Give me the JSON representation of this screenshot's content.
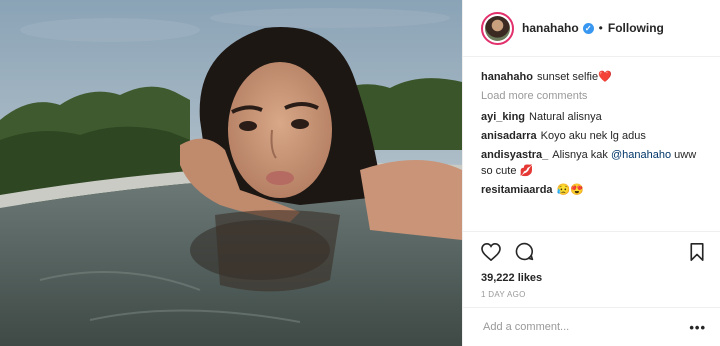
{
  "post": {
    "username": "hanahaho",
    "follow_status": "Following",
    "separator": "•",
    "caption": {
      "user": "hanahaho",
      "text": "sunset selfie",
      "emoji": "❤️"
    },
    "load_more": "Load more comments",
    "comments": [
      {
        "user": "ayi_king",
        "text": "Natural alisnya"
      },
      {
        "user": "anisadarra",
        "text": "Koyo aku nek lg adus"
      },
      {
        "user": "andisyastra_",
        "text_before": "Alisnya kak",
        "mention": "@hanahaho",
        "text_after": "uww so cute 💋"
      },
      {
        "user": "resitamiaarda",
        "text": "😥😍"
      }
    ],
    "likes": "39,222 likes",
    "time": "1 DAY AGO",
    "add_comment_placeholder": "Add a comment...",
    "more_label": "•••"
  },
  "icons": {
    "like": "heart-outline-icon",
    "comment": "speech-bubble-icon",
    "save": "bookmark-icon",
    "verified": "verified-badge-icon"
  },
  "colors": {
    "avatar_ring": "#e1306c",
    "verified": "#3897f0",
    "muted": "#999999",
    "divider": "#efefef"
  }
}
